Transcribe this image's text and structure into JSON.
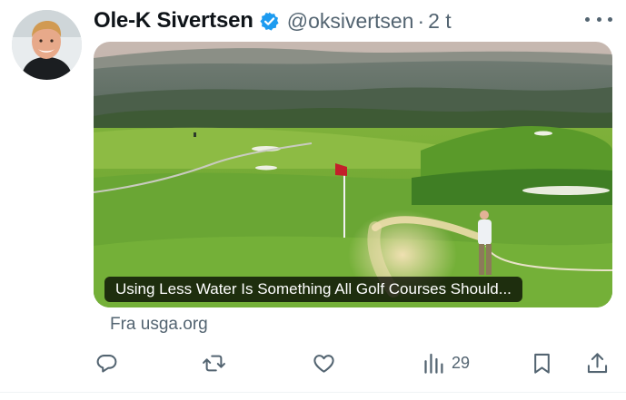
{
  "author": {
    "name": "Ole-K Sivertsen",
    "handle": "@oksivertsen",
    "separator": "·",
    "time": "2 t",
    "verified": true
  },
  "card": {
    "headline": "Using Less Water Is Something All Golf Courses Should...",
    "source": "Fra usga.org"
  },
  "actions": {
    "views_count": "29"
  },
  "icons": {
    "reply": "reply-icon",
    "repost": "repost-icon",
    "like": "like-icon",
    "views": "views-icon",
    "bookmark": "bookmark-icon",
    "share": "share-icon",
    "more": "more-icon",
    "verified": "verified-badge-icon"
  },
  "colors": {
    "text": "#0f1419",
    "secondary": "#536471",
    "verified": "#1d9bf0"
  }
}
